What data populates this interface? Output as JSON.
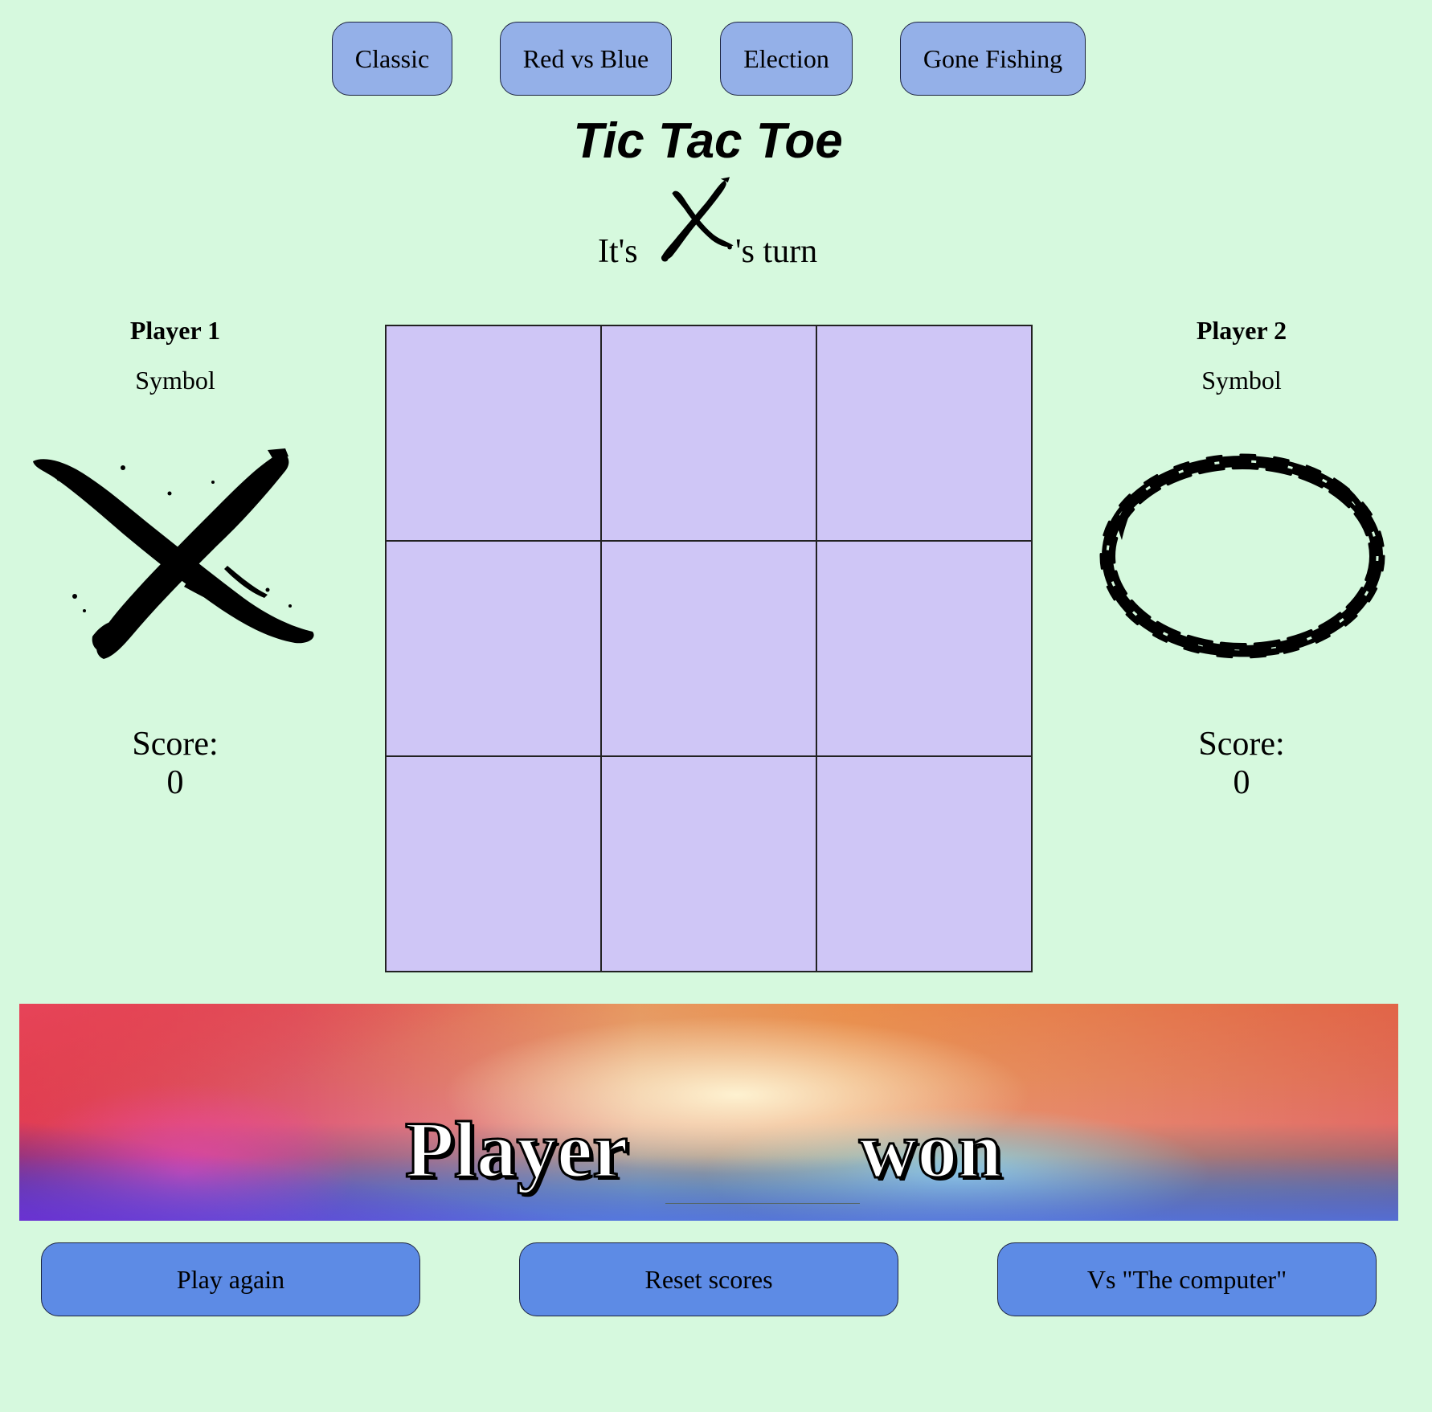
{
  "themes": [
    {
      "label": "Classic"
    },
    {
      "label": "Red vs Blue"
    },
    {
      "label": "Election"
    },
    {
      "label": "Gone Fishing"
    }
  ],
  "title": "Tic Tac Toe",
  "turn": {
    "prefix": "It's",
    "current_symbol": "x-brush-icon",
    "suffix": "'s turn"
  },
  "player1": {
    "name": "Player 1",
    "symbol_label": "Symbol",
    "symbol": "x-brush-icon",
    "score_label": "Score:",
    "score": "0"
  },
  "player2": {
    "name": "Player 2",
    "symbol_label": "Symbol",
    "symbol": "o-brush-icon",
    "score_label": "Score:",
    "score": "0"
  },
  "board": {
    "cells": [
      "",
      "",
      "",
      "",
      "",
      "",
      "",
      "",
      ""
    ]
  },
  "banner": {
    "prefix": "Player",
    "winner": "",
    "suffix": "won"
  },
  "actions": {
    "play_again": "Play again",
    "reset_scores": "Reset scores",
    "vs_computer": "Vs \"The computer\""
  },
  "colors": {
    "background": "#d6f9de",
    "theme_button": "#94b0e8",
    "action_button": "#5d8be5",
    "board_cell": "#cfc6f6"
  }
}
